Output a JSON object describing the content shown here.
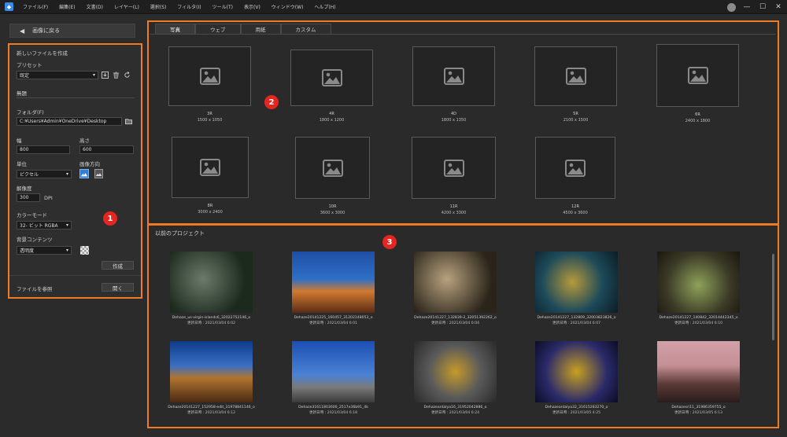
{
  "menu": [
    "ファイル(F)",
    "編集(E)",
    "文書(D)",
    "レイヤー(L)",
    "選択(S)",
    "フィルタ(I)",
    "ツール(T)",
    "表示(V)",
    "ウィンドウ(W)",
    "ヘルプ(H)"
  ],
  "back_label": "画像に戻る",
  "new_file": {
    "title": "新しいファイルを作成",
    "preset_label": "プリセット",
    "preset_value": "既定",
    "name_value": "無題",
    "folder_label": "フォルダ(F)",
    "folder_value": "C:¥Users¥Admin¥OneDrive¥Desktop",
    "width_label": "幅",
    "width_value": "800",
    "height_label": "高さ",
    "height_value": "600",
    "unit_label": "単位",
    "unit_value": "ピクセル",
    "orientation_label": "画像方向",
    "resolution_label": "解像度",
    "resolution_value": "300",
    "resolution_unit": "DPI",
    "color_mode_label": "カラーモード",
    "color_mode_value": "32- ビット RGBA",
    "bg_label": "背景コンテンツ",
    "bg_value": "透明度",
    "create_label": "作成",
    "browse_label": "ファイルを参照",
    "open_label": "開く"
  },
  "tabs": [
    "写真",
    "ウェブ",
    "用紙",
    "カスタム"
  ],
  "presets": [
    {
      "name": "3R",
      "size": "1500 x 1050"
    },
    {
      "name": "4R",
      "size": "1800 x 1200"
    },
    {
      "name": "4D",
      "size": "1800 x 1350"
    },
    {
      "name": "5R",
      "size": "2100 x 1500"
    },
    {
      "name": "6R",
      "size": "2400 x 1800"
    },
    {
      "name": "8R",
      "size": "3000 x 2400"
    },
    {
      "name": "10R",
      "size": "3600 x 3000"
    },
    {
      "name": "11R",
      "size": "4200 x 3300"
    },
    {
      "name": "12R",
      "size": "4500 x 3600"
    }
  ],
  "projects_title": "以前のプロジェクト",
  "projects": [
    {
      "name": "Dehaze_us-virgin-islands6_32022752146_o",
      "date": "更新日時 : 2021/03/04 6:02"
    },
    {
      "name": "Dehaze20141225_160457_31202148053_o",
      "date": "更新日時 : 2021/03/04 6:01"
    },
    {
      "name": "Dehaze20141227_132839-2_32051392262_o",
      "date": "更新日時 : 2021/03/04 6:04"
    },
    {
      "name": "Dehaze20141227_132809_32003823826_o",
      "date": "更新日時 : 2021/03/04 6:07"
    },
    {
      "name": "Dehaze20141227_140842_32014442345_o",
      "date": "更新日時 : 2021/03/04 6:10"
    },
    {
      "name": "Dehaze20141227_152958-edit_31978841146_o",
      "date": "更新日時 : 2021/03/04 6:12"
    },
    {
      "name": "Dehaze31611803600_2517e36b91_4k",
      "date": "更新日時 : 2021/03/04 6:18"
    },
    {
      "name": "Dehazeantalya16_31952042886_o",
      "date": "更新日時 : 2021/03/04 6:24"
    },
    {
      "name": "Dehazeantalya32_31615283270_o",
      "date": "更新日時 : 2021/03/05 4:25"
    },
    {
      "name": "Dehazesri11_31986359755_o",
      "date": "更新日時 : 2021/03/05 6:13"
    }
  ],
  "badges": [
    "1",
    "2",
    "3"
  ],
  "colors": {
    "accent": "#f07b22",
    "badge": "#e5251f",
    "app": "#3a8be6"
  }
}
